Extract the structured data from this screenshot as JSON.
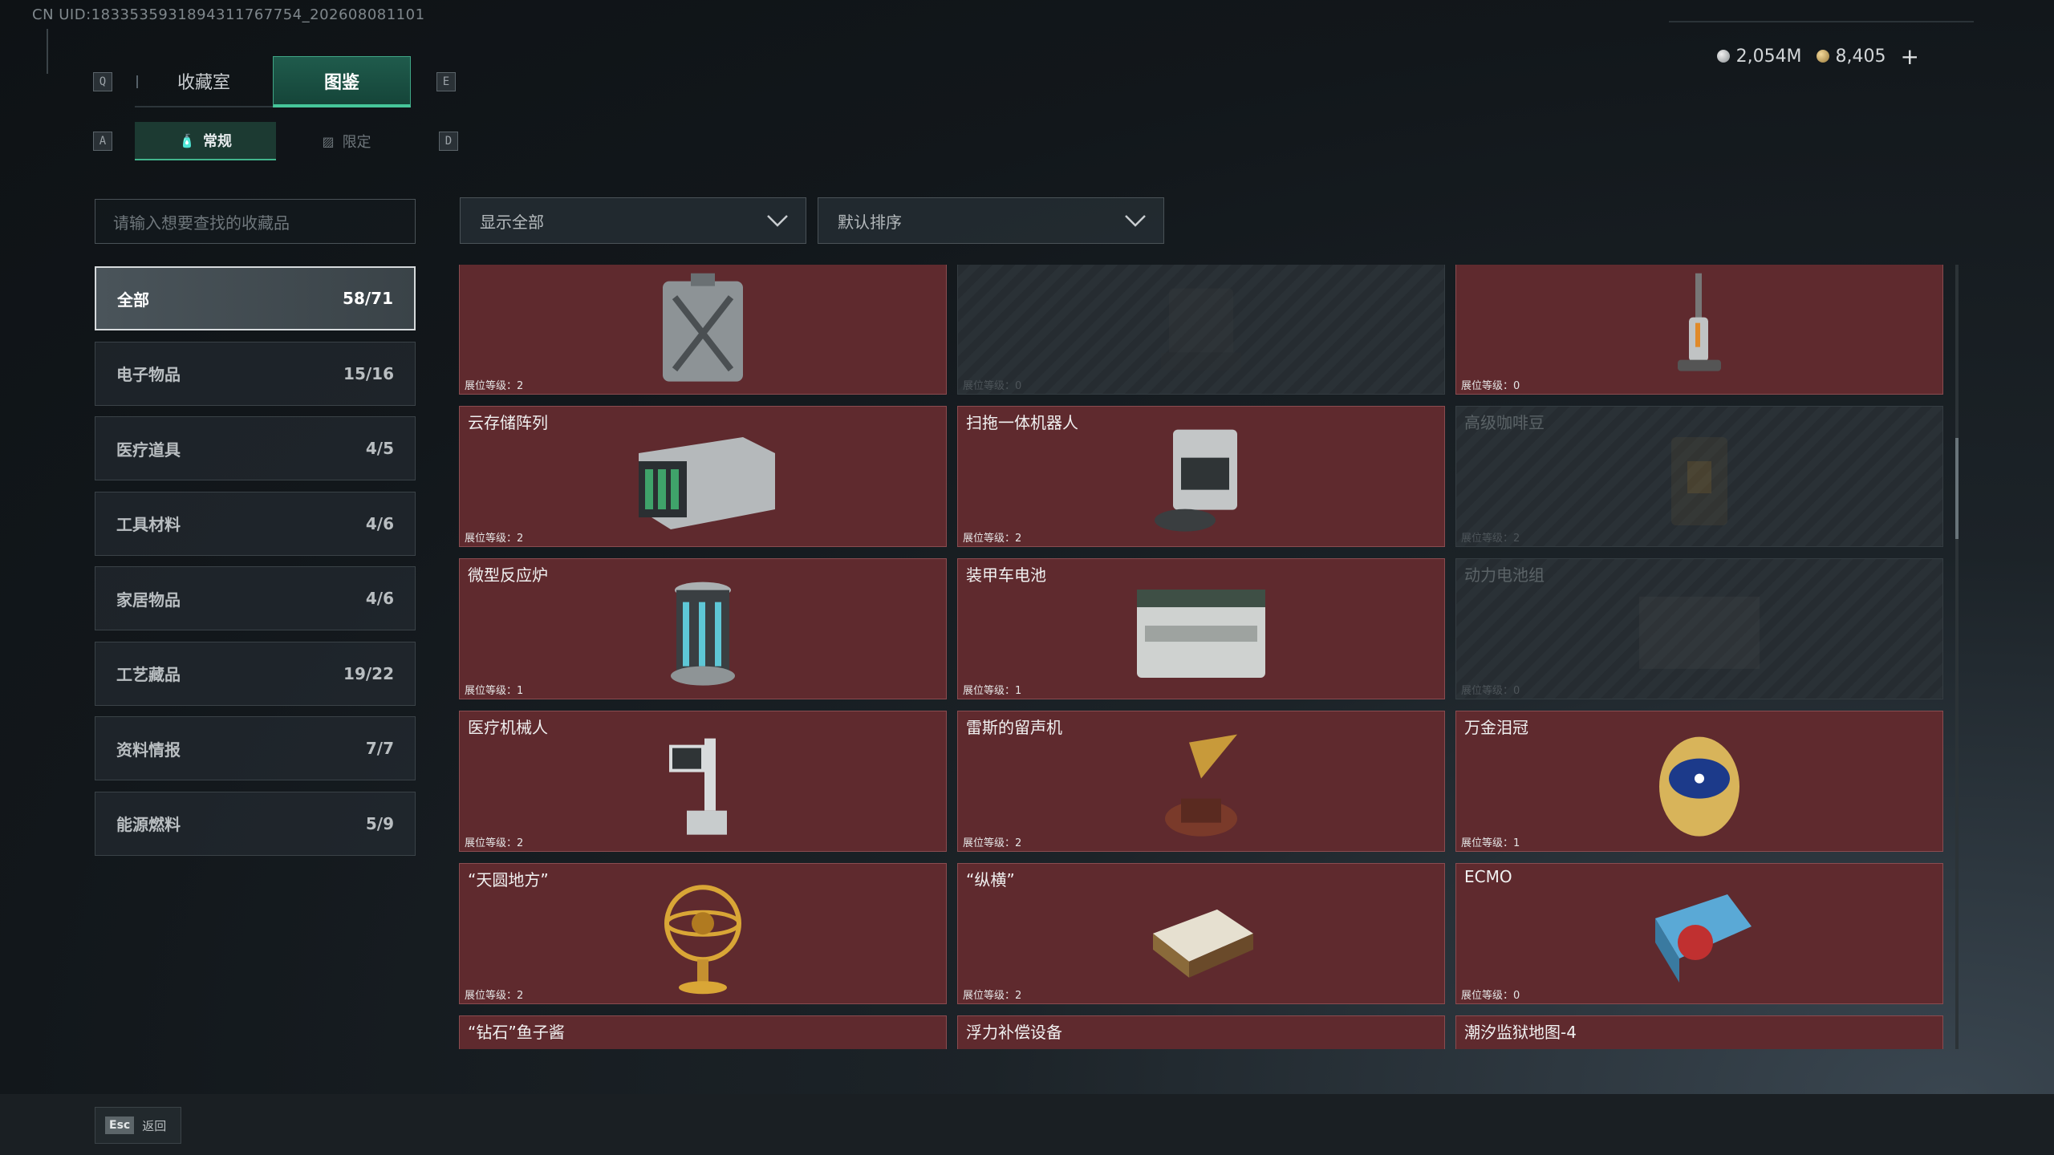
{
  "uid": "CN UID:1833535931894311767754_202608081101",
  "keys": {
    "q": "Q",
    "e": "E",
    "a": "A",
    "d": "D"
  },
  "tabs": [
    {
      "label": "收藏室",
      "active": false
    },
    {
      "label": "图鉴",
      "active": true
    }
  ],
  "subtabs": [
    {
      "label": "常规",
      "icon": "bottle-icon",
      "active": true
    },
    {
      "label": "限定",
      "icon": "image-icon",
      "active": false
    }
  ],
  "currency": {
    "silver": "2,054M",
    "gold": "8,405",
    "plus": "+"
  },
  "search": {
    "placeholder": "请输入想要查找的收藏品"
  },
  "filters": {
    "show": "显示全部",
    "sort": "默认排序"
  },
  "categories": [
    {
      "label": "全部",
      "count": "58/71",
      "active": true
    },
    {
      "label": "电子物品",
      "count": "15/16"
    },
    {
      "label": "医疗道具",
      "count": "4/5"
    },
    {
      "label": "工具材料",
      "count": "4/6"
    },
    {
      "label": "家居物品",
      "count": "4/6"
    },
    {
      "label": "工艺藏品",
      "count": "19/22"
    },
    {
      "label": "资料情报",
      "count": "7/7"
    },
    {
      "label": "能源燃料",
      "count": "5/9"
    }
  ],
  "items": [
    {
      "name": "",
      "level": "展位等级：2",
      "locked": false,
      "icon": "jerrycan-icon"
    },
    {
      "name": "",
      "level": "展位等级：0",
      "locked": true,
      "icon": "machine-icon"
    },
    {
      "name": "",
      "level": "展位等级：0",
      "locked": false,
      "icon": "floor-washer-icon"
    },
    {
      "name": "云存储阵列",
      "level": "展位等级：2",
      "locked": false,
      "icon": "storage-array-icon"
    },
    {
      "name": "扫拖一体机器人",
      "level": "展位等级：2",
      "locked": false,
      "icon": "robot-vacuum-icon"
    },
    {
      "name": "高级咖啡豆",
      "level": "展位等级：2",
      "locked": true,
      "icon": "coffee-bag-icon"
    },
    {
      "name": "微型反应炉",
      "level": "展位等级：1",
      "locked": false,
      "icon": "reactor-icon"
    },
    {
      "name": "装甲车电池",
      "level": "展位等级：1",
      "locked": false,
      "icon": "battery-icon"
    },
    {
      "name": "动力电池组",
      "level": "展位等级：0",
      "locked": true,
      "icon": "battery-pack-icon"
    },
    {
      "name": "医疗机械人",
      "level": "展位等级：2",
      "locked": false,
      "icon": "medical-robot-icon"
    },
    {
      "name": "雷斯的留声机",
      "level": "展位等级：2",
      "locked": false,
      "icon": "gramophone-icon"
    },
    {
      "name": "万金泪冠",
      "level": "展位等级：1",
      "locked": false,
      "icon": "jeweled-egg-icon"
    },
    {
      "name": "“天圆地方”",
      "level": "展位等级：2",
      "locked": false,
      "icon": "armillary-sphere-icon"
    },
    {
      "name": "“纵横”",
      "level": "展位等级：2",
      "locked": false,
      "icon": "chessboard-icon"
    },
    {
      "name": "ECMO",
      "level": "展位等级：0",
      "locked": false,
      "icon": "ecmo-icon"
    },
    {
      "name": "“钻石”鱼子酱",
      "level": "",
      "locked": false,
      "icon": "caviar-icon"
    },
    {
      "name": "浮力补偿设备",
      "level": "",
      "locked": false,
      "icon": "bcd-icon"
    },
    {
      "name": "潮汐监狱地图-4",
      "level": "",
      "locked": false,
      "icon": "map-icon"
    }
  ],
  "back": {
    "key": "Esc",
    "label": "返回"
  }
}
